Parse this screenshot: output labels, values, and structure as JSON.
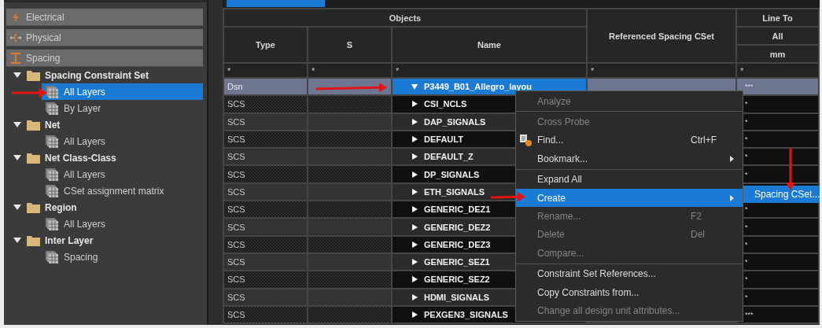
{
  "panel_tabs": [
    {
      "label": "Electrical",
      "kind": "electrical"
    },
    {
      "label": "Physical",
      "kind": "physical"
    },
    {
      "label": "Spacing",
      "kind": "spacing"
    }
  ],
  "tree": [
    {
      "label": "Spacing Constraint Set",
      "expanded": true,
      "selected": false,
      "children": [
        {
          "label": "All Layers",
          "selected": true
        },
        {
          "label": "By Layer",
          "selected": false
        }
      ]
    },
    {
      "label": "Net",
      "expanded": true,
      "selected": false,
      "children": [
        {
          "label": "All Layers",
          "selected": false
        }
      ]
    },
    {
      "label": "Net Class-Class",
      "expanded": true,
      "selected": false,
      "children": [
        {
          "label": "All Layers",
          "selected": false
        },
        {
          "label": "CSet assignment matrix",
          "selected": false
        }
      ]
    },
    {
      "label": "Region",
      "expanded": true,
      "selected": false,
      "children": [
        {
          "label": "All Layers",
          "selected": false
        }
      ]
    },
    {
      "label": "Inter Layer",
      "expanded": true,
      "selected": false,
      "children": [
        {
          "label": "Spacing",
          "selected": false
        }
      ]
    }
  ],
  "table": {
    "group_header": "Objects",
    "columns": [
      "Type",
      "S",
      "Name",
      "Referenced Spacing CSet"
    ],
    "line_to": {
      "title": "Line To",
      "subtitle": "All",
      "unit": "mm"
    },
    "filters": [
      "*",
      "*",
      "*",
      "*",
      "*"
    ],
    "rows": [
      {
        "type": "Dsn",
        "name": "P3449_B01_Allegro_layou",
        "expanded": true,
        "selected": true,
        "line_to": "***"
      },
      {
        "type": "SCS",
        "name": "CSI_NCLS",
        "expanded": false,
        "selected": false,
        "line_to": "*"
      },
      {
        "type": "SCS",
        "name": "DAP_SIGNALS",
        "expanded": false,
        "selected": false,
        "line_to": "*"
      },
      {
        "type": "SCS",
        "name": "DEFAULT",
        "expanded": false,
        "selected": false,
        "line_to": "*"
      },
      {
        "type": "SCS",
        "name": "DEFAULT_Z",
        "expanded": false,
        "selected": false,
        "line_to": "*"
      },
      {
        "type": "SCS",
        "name": "DP_SIGNALS",
        "expanded": false,
        "selected": false,
        "line_to": "*"
      },
      {
        "type": "SCS",
        "name": "ETH_SIGNALS",
        "expanded": false,
        "selected": false
      },
      {
        "type": "SCS",
        "name": "GENERIC_DEZ1",
        "expanded": false,
        "selected": false,
        "line_to": "*"
      },
      {
        "type": "SCS",
        "name": "GENERIC_DEZ2",
        "expanded": false,
        "selected": false,
        "line_to": "*"
      },
      {
        "type": "SCS",
        "name": "GENERIC_DEZ3",
        "expanded": false,
        "selected": false,
        "line_to": "*"
      },
      {
        "type": "SCS",
        "name": "GENERIC_SEZ1",
        "expanded": false,
        "selected": false,
        "line_to": "*"
      },
      {
        "type": "SCS",
        "name": "GENERIC_SEZ2",
        "expanded": false,
        "selected": false,
        "line_to": "*"
      },
      {
        "type": "SCS",
        "name": "HDMI_SIGNALS",
        "expanded": false,
        "selected": false,
        "line_to": "*"
      },
      {
        "type": "SCS",
        "name": "PEXGEN3_SIGNALS",
        "expanded": false,
        "selected": false,
        "line_to": "***"
      }
    ]
  },
  "context_menu": {
    "items": [
      {
        "kind": "item",
        "label": "Analyze",
        "disabled": true,
        "selected": false
      },
      {
        "kind": "separator"
      },
      {
        "kind": "item",
        "label": "Cross Probe",
        "disabled": true,
        "selected": false
      },
      {
        "kind": "item",
        "label": "Find...",
        "shortcut": "Ctrl+F",
        "has_icon": true,
        "disabled": false,
        "selected": false
      },
      {
        "kind": "item",
        "label": "Bookmark...",
        "submenu": true,
        "disabled": false,
        "selected": false
      },
      {
        "kind": "separator"
      },
      {
        "kind": "item",
        "label": "Expand All",
        "disabled": false,
        "selected": false
      },
      {
        "kind": "item",
        "label": "Create",
        "submenu": true,
        "disabled": false,
        "selected": true
      },
      {
        "kind": "item",
        "label": "Rename...",
        "shortcut": "F2",
        "disabled": true,
        "selected": false
      },
      {
        "kind": "item",
        "label": "Delete",
        "shortcut": "Del",
        "disabled": true,
        "selected": false
      },
      {
        "kind": "item",
        "label": "Compare...",
        "disabled": true,
        "selected": false
      },
      {
        "kind": "separator"
      },
      {
        "kind": "item",
        "label": "Constraint Set References...",
        "disabled": false,
        "selected": false
      },
      {
        "kind": "item",
        "label": "Copy Constraints from...",
        "disabled": false,
        "selected": false
      },
      {
        "kind": "item",
        "label": "Change all design unit attributes...",
        "disabled": true,
        "selected": false
      }
    ]
  },
  "submenu": {
    "items": [
      {
        "label": "Spacing CSet...",
        "selected": true
      }
    ]
  }
}
